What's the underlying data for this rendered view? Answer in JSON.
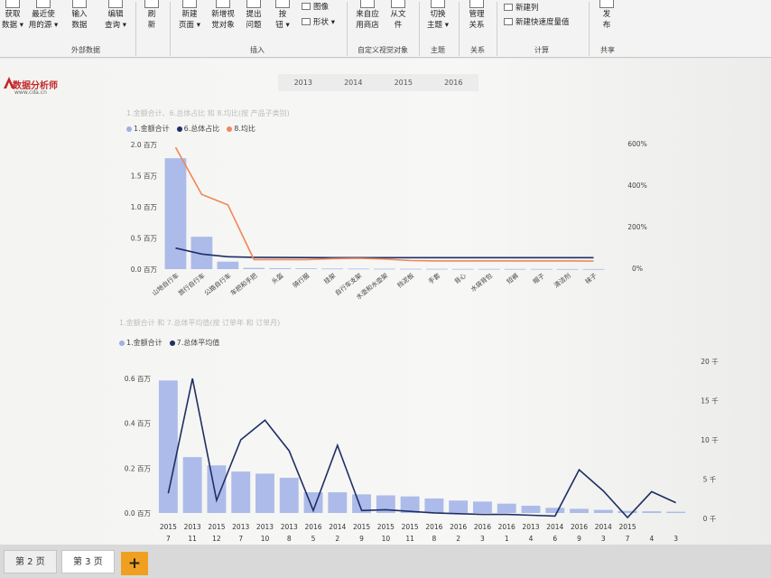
{
  "ribbon": {
    "buttons": [
      {
        "label1": "获取",
        "label2": "数据 ▾"
      },
      {
        "label1": "最近使",
        "label2": "用的源 ▾"
      },
      {
        "label1": "输入",
        "label2": "数据"
      },
      {
        "label1": "编辑",
        "label2": "查询 ▾"
      },
      {
        "label1": "刷",
        "label2": "新"
      },
      {
        "label1": "新建",
        "label2": "页面 ▾"
      },
      {
        "label1": "新增视",
        "label2": "觉对象"
      },
      {
        "label1": "提出",
        "label2": "问题"
      },
      {
        "label1": "按",
        "label2": "钮 ▾"
      },
      {
        "label1": "来自应",
        "label2": "用商店"
      },
      {
        "label1": "从文",
        "label2": "件"
      },
      {
        "label1": "切换",
        "label2": "主题 ▾"
      },
      {
        "label1": "管理",
        "label2": "关系"
      },
      {
        "label1": "发",
        "label2": "布"
      }
    ],
    "small_items": {
      "image": "图像",
      "shapes": "形状 ▾",
      "new_column": "新建列",
      "new_quick_measure": "新建快速度量值"
    },
    "groups": {
      "external_data": "外部数据",
      "insert": "插入",
      "custom_visuals": "自定义视觉对象",
      "themes": "主题",
      "relationships": "关系",
      "calculations": "计算",
      "share": "共享"
    }
  },
  "logo": {
    "title": "数据分析师",
    "site": "www.cda.cn"
  },
  "slicer": {
    "years": [
      "2013",
      "2014",
      "2015",
      "2016"
    ]
  },
  "colors": {
    "bar": "#9fb0e6",
    "dark_line": "#1f2e66",
    "orange_line": "#f0875a",
    "tab_add": "#f0a020"
  },
  "chart1": {
    "title": "1.金额合计、6.总体占比 和 8.均比(按 产品子类别)",
    "legend": [
      "1.金额合计",
      "6.总体占比",
      "8.均比"
    ]
  },
  "chart2": {
    "title": "1.金额合计 和 7.总体平均值(按 订单年 和 订单月)",
    "legend": [
      "1.金额合计",
      "7.总体平均值"
    ]
  },
  "chart_data": [
    {
      "type": "bar",
      "categories": [
        "山地自行车",
        "旅行自行车",
        "公路自行车",
        "车把和手把",
        "头盔",
        "骑行服",
        "挂架",
        "自行车支架",
        "水壶和水壶架",
        "挡泥板",
        "手套",
        "背心",
        "水袋背包",
        "短裤",
        "帽子",
        "清洁剂",
        "袜子"
      ],
      "y_ticks": [
        "0.0 百万",
        "0.5 百万",
        "1.0 百万",
        "1.5 百万",
        "2.0 百万"
      ],
      "y2_ticks": [
        "0%",
        "200%",
        "400%",
        "600%"
      ],
      "ylim": [
        0,
        2.0
      ],
      "y2lim": [
        -50,
        600
      ],
      "series": [
        {
          "name": "1.金额合计",
          "kind": "bar",
          "values": [
            1.78,
            0.52,
            0.12,
            0.02,
            0.015,
            0.012,
            0.01,
            0.008,
            0.007,
            0.006,
            0.005,
            0.004,
            0.004,
            0.003,
            0.003,
            0.002,
            0.002
          ]
        },
        {
          "name": "6.总体占比",
          "kind": "line",
          "values": [
            55,
            24,
            10,
            7,
            6,
            5.5,
            5,
            5,
            5,
            5,
            5,
            5,
            5,
            5,
            5,
            5,
            5
          ]
        },
        {
          "name": "8.均比",
          "kind": "line",
          "values": [
            580,
            335,
            280,
            -5,
            -5,
            -5,
            0,
            2,
            -2,
            -10,
            -12,
            -12,
            -12,
            -12,
            -12,
            -12,
            -13
          ]
        }
      ]
    },
    {
      "type": "bar",
      "x_years": [
        "2015",
        "2013",
        "2015",
        "2013",
        "2013",
        "2013",
        "2016",
        "2014",
        "2015",
        "2015",
        "2015",
        "2016",
        "2016",
        "2016",
        "2016",
        "2013",
        "2014",
        "2016",
        "2014",
        "2015"
      ],
      "x_months": [
        "7",
        "11",
        "12",
        "7",
        "10",
        "8",
        "5",
        "2",
        "9",
        "10",
        "11",
        "8",
        "2",
        "3",
        "1",
        "4",
        "6",
        "9",
        "3",
        "7",
        "4",
        "3"
      ],
      "y_ticks": [
        "0.0 百万",
        "0.2 百万",
        "0.4 百万",
        "0.6 百万"
      ],
      "y2_ticks": [
        "0 千",
        "5 千",
        "10 千",
        "15 千",
        "20 千"
      ],
      "ylim": [
        0,
        0.65
      ],
      "y2lim": [
        0,
        20
      ],
      "series": [
        {
          "name": "1.金额合计",
          "kind": "bar",
          "values": [
            0.64,
            0.27,
            0.23,
            0.2,
            0.19,
            0.17,
            0.1,
            0.1,
            0.09,
            0.085,
            0.08,
            0.07,
            0.06,
            0.055,
            0.045,
            0.035,
            0.025,
            0.02,
            0.015,
            0.01,
            0.008,
            0.006
          ]
        },
        {
          "name": "7.总体平均值",
          "kind": "line",
          "values": [
            3.2,
            17.8,
            2.3,
            10.0,
            12.5,
            8.6,
            1.0,
            9.3,
            1.0,
            1.1,
            0.9,
            0.7,
            0.6,
            0.5,
            0.5,
            0.4,
            0.3,
            6.2,
            3.5,
            0.1,
            3.4,
            2.0
          ]
        }
      ]
    }
  ],
  "tabs": [
    {
      "label": "第 2 页"
    },
    {
      "label": "第 3 页"
    }
  ],
  "add_tab_label": "+"
}
